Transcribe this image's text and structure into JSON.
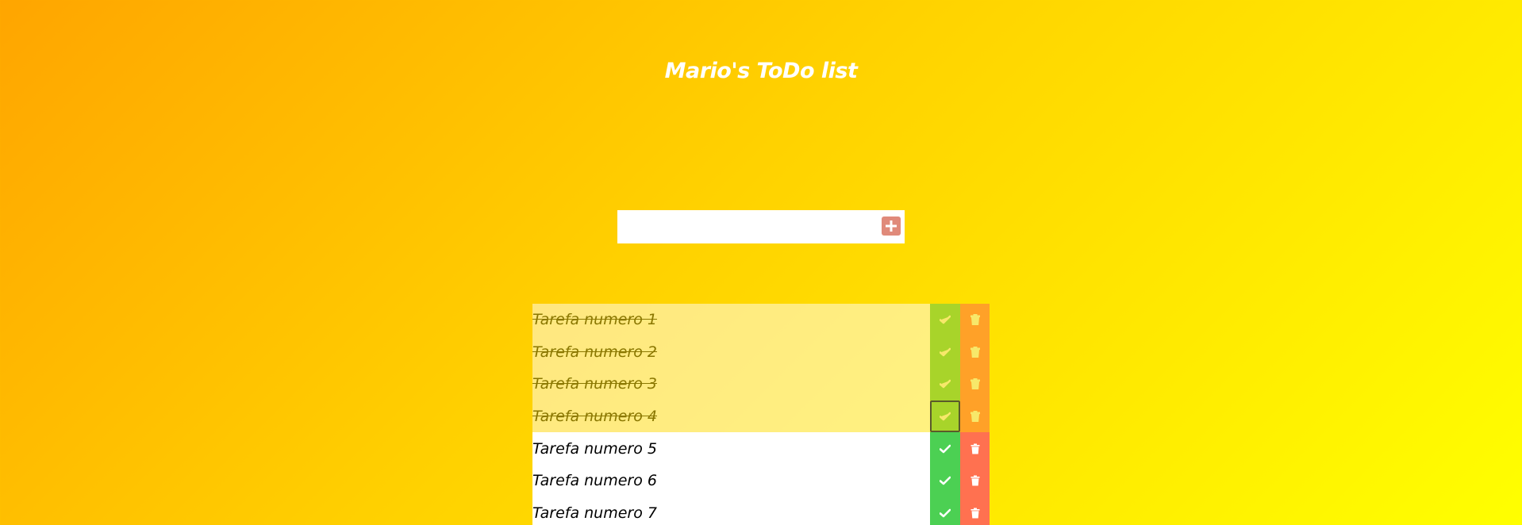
{
  "app": {
    "title": "Mario's ToDo list"
  },
  "add_form": {
    "input_value": "",
    "input_placeholder": "",
    "add_icon": "plus-square-icon",
    "add_button_color": "#e08a7a"
  },
  "todos": [
    {
      "text": "Tarefa numero 1",
      "completed": true
    },
    {
      "text": "Tarefa numero 2",
      "completed": true
    },
    {
      "text": "Tarefa numero 3",
      "completed": true
    },
    {
      "text": "Tarefa numero 4",
      "completed": true
    },
    {
      "text": "Tarefa numero 5",
      "completed": false
    },
    {
      "text": "Tarefa numero 6",
      "completed": false
    },
    {
      "text": "Tarefa numero 7",
      "completed": false
    }
  ],
  "icons": {
    "complete": "check-icon",
    "delete": "trash-icon"
  },
  "colors": {
    "background_start": "#ffa500",
    "background_end": "#ffff00",
    "check_active": "#4cd053",
    "trash_active": "#ff7150",
    "check_done": "#a8d42a",
    "trash_done": "#ffa128"
  }
}
